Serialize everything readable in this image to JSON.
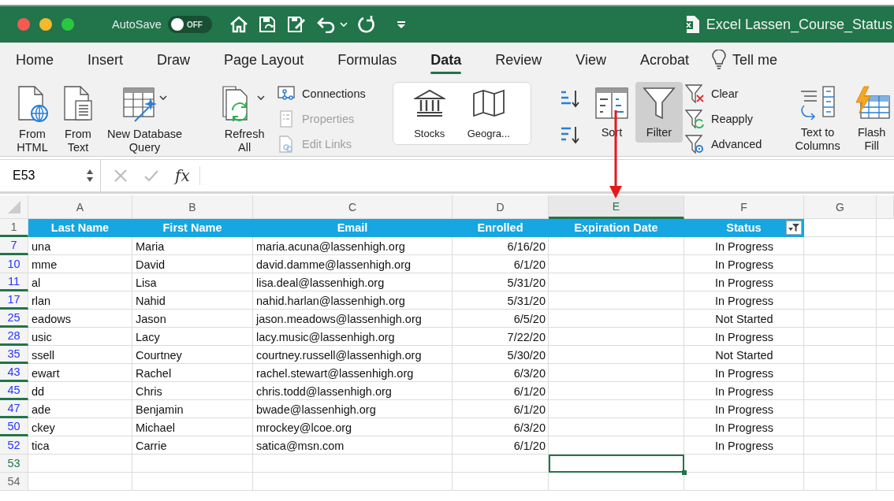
{
  "window": {
    "title": "Excel Lassen_Course_Status",
    "autosave": {
      "label": "AutoSave",
      "on": false,
      "state": "OFF"
    }
  },
  "tabs": [
    {
      "label": "Home",
      "selected": false
    },
    {
      "label": "Insert",
      "selected": false
    },
    {
      "label": "Draw",
      "selected": false
    },
    {
      "label": "Page Layout",
      "selected": false
    },
    {
      "label": "Formulas",
      "selected": false
    },
    {
      "label": "Data",
      "selected": true
    },
    {
      "label": "Review",
      "selected": false
    },
    {
      "label": "View",
      "selected": false
    },
    {
      "label": "Acrobat",
      "selected": false
    }
  ],
  "tell_me": "Tell me",
  "ribbon": {
    "get_data": [
      {
        "kind": "html",
        "lines": [
          "From",
          "HTML"
        ]
      },
      {
        "kind": "text",
        "lines": [
          "From",
          "Text"
        ]
      },
      {
        "kind": "database",
        "lines": [
          "New Database",
          "Query"
        ]
      }
    ],
    "refresh": {
      "lines": [
        "Refresh",
        "All"
      ]
    },
    "queries": [
      {
        "kind": "connections",
        "label": "Connections",
        "disabled": false
      },
      {
        "kind": "properties",
        "label": "Properties",
        "disabled": true
      },
      {
        "kind": "links",
        "label": "Edit Links",
        "disabled": true
      }
    ],
    "data_types": [
      {
        "kind": "stocks",
        "label": "Stocks"
      },
      {
        "kind": "geography",
        "label": "Geogra..."
      }
    ],
    "sort": {
      "label": "Sort"
    },
    "filter": {
      "label": "Filter",
      "on": true
    },
    "filter_actions": [
      {
        "kind": "clear",
        "label": "Clear"
      },
      {
        "kind": "reapply",
        "label": "Reapply"
      },
      {
        "kind": "advanced",
        "label": "Advanced"
      }
    ],
    "tools": [
      {
        "kind": "columns",
        "lines": [
          "Text to",
          "Columns"
        ]
      },
      {
        "kind": "flash",
        "lines": [
          "Flash",
          "Fill"
        ]
      }
    ]
  },
  "formula_bar": {
    "name_box": "E53",
    "function_label": "fx"
  },
  "sheet": {
    "columns": [
      {
        "label": "A",
        "selected": false
      },
      {
        "label": "B",
        "selected": false
      },
      {
        "label": "C",
        "selected": false
      },
      {
        "label": "D",
        "selected": false
      },
      {
        "label": "E",
        "selected": true
      },
      {
        "label": "F",
        "selected": false
      },
      {
        "label": "G",
        "selected": false
      }
    ],
    "header_row": {
      "number": "1",
      "hidden_below": true,
      "cells": [
        {
          "text": "Last Name",
          "filtered": false
        },
        {
          "text": "First Name",
          "filtered": false
        },
        {
          "text": "Email",
          "filtered": false
        },
        {
          "text": "Enrolled",
          "filtered": false
        },
        {
          "text": "Expiration Date",
          "filtered": false
        },
        {
          "text": "Status",
          "filtered": true
        }
      ]
    },
    "rows": [
      {
        "number": "7",
        "last_name": "una",
        "first_name": "Maria",
        "email": "maria.acuna@lassenhigh.org",
        "enrolled": "6/16/20",
        "status": "In Progress",
        "filtered": true,
        "hidden_below": true,
        "active": false
      },
      {
        "number": "10",
        "last_name": "mme",
        "first_name": "David",
        "email": "david.damme@lassenhigh.org",
        "enrolled": "6/1/20",
        "status": "In Progress",
        "filtered": true,
        "hidden_below": false,
        "active": false
      },
      {
        "number": "11",
        "last_name": "al",
        "first_name": "Lisa",
        "email": "lisa.deal@lassenhigh.org",
        "enrolled": "5/31/20",
        "status": "In Progress",
        "filtered": true,
        "hidden_below": true,
        "active": false
      },
      {
        "number": "17",
        "last_name": "rlan",
        "first_name": "Nahid",
        "email": "nahid.harlan@lassenhigh.org",
        "enrolled": "5/31/20",
        "status": "In Progress",
        "filtered": true,
        "hidden_below": true,
        "active": false
      },
      {
        "number": "25",
        "last_name": "eadows",
        "first_name": "Jason",
        "email": "jason.meadows@lassenhigh.org",
        "enrolled": "6/5/20",
        "status": "Not Started",
        "filtered": true,
        "hidden_below": true,
        "active": false
      },
      {
        "number": "28",
        "last_name": "usic",
        "first_name": "Lacy",
        "email": "lacy.music@lassenhigh.org",
        "enrolled": "7/22/20",
        "status": "In Progress",
        "filtered": true,
        "hidden_below": true,
        "active": false
      },
      {
        "number": "35",
        "last_name": "ssell",
        "first_name": "Courtney",
        "email": "courtney.russell@lassenhigh.org",
        "enrolled": "5/30/20",
        "status": "Not Started",
        "filtered": true,
        "hidden_below": true,
        "active": false
      },
      {
        "number": "43",
        "last_name": "ewart",
        "first_name": "Rachel",
        "email": "rachel.stewart@lassenhigh.org",
        "enrolled": "6/3/20",
        "status": "In Progress",
        "filtered": true,
        "hidden_below": true,
        "active": false
      },
      {
        "number": "45",
        "last_name": "dd",
        "first_name": "Chris",
        "email": "chris.todd@lassenhigh.org",
        "enrolled": "6/1/20",
        "status": "In Progress",
        "filtered": true,
        "hidden_below": true,
        "active": false
      },
      {
        "number": "47",
        "last_name": "ade",
        "first_name": "Benjamin",
        "email": "bwade@lassenhigh.org",
        "enrolled": "6/1/20",
        "status": "In Progress",
        "filtered": true,
        "hidden_below": true,
        "active": false
      },
      {
        "number": "50",
        "last_name": "ckey",
        "first_name": "Michael",
        "email": "mrockey@lcoe.org",
        "enrolled": "6/3/20",
        "status": "In Progress",
        "filtered": true,
        "hidden_below": true,
        "active": false
      },
      {
        "number": "52",
        "last_name": "tica",
        "first_name": "Carrie",
        "email": "satica@msn.com",
        "enrolled": "6/1/20",
        "status": "In Progress",
        "filtered": true,
        "hidden_below": false,
        "active": false
      },
      {
        "number": "53",
        "filtered": false,
        "hidden_below": false,
        "active": true
      },
      {
        "number": "54",
        "filtered": false,
        "hidden_below": false,
        "active": false
      }
    ]
  }
}
